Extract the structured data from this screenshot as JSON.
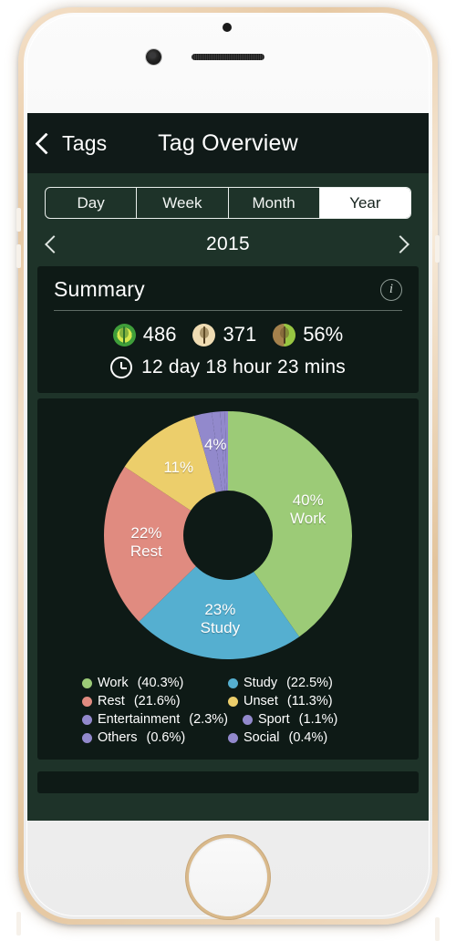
{
  "navbar": {
    "back_label": "Tags",
    "back_icon": "chevron-left-icon",
    "title": "Tag Overview"
  },
  "segmented": {
    "options": [
      "Day",
      "Week",
      "Month",
      "Year"
    ],
    "selected": "Year"
  },
  "period": {
    "prev_icon": "chevron-left-icon",
    "next_icon": "chevron-right-icon",
    "label": "2015"
  },
  "summary": {
    "title": "Summary",
    "info_icon": "info-icon",
    "stats": [
      {
        "icon": "tree-alive-icon",
        "value": "486"
      },
      {
        "icon": "tree-dead-icon",
        "value": "371"
      },
      {
        "icon": "tree-split-icon",
        "value": "56%"
      }
    ],
    "time_icon": "clock-icon",
    "time_text": "12 day 18 hour 23 mins"
  },
  "chart_data": {
    "type": "pie",
    "title": "",
    "donut": true,
    "start_angle_deg": 0,
    "direction": "clockwise",
    "categories": [
      "Work",
      "Study",
      "Rest",
      "Unset",
      "Entertainment",
      "Sport",
      "Others",
      "Social"
    ],
    "values": [
      40.3,
      22.5,
      21.6,
      11.3,
      2.3,
      1.1,
      0.6,
      0.4
    ],
    "colors": [
      "#9ccb77",
      "#55afd0",
      "#e08b80",
      "#ecce6b",
      "#9289cc",
      "#9289cc",
      "#9289cc",
      "#9289cc"
    ],
    "slice_labels": [
      {
        "pct": "40%",
        "name": "Work"
      },
      {
        "pct": "23%",
        "name": "Study"
      },
      {
        "pct": "22%",
        "name": "Rest"
      },
      {
        "pct": "11%",
        "name": ""
      },
      {
        "pct": "4%",
        "name": ""
      }
    ],
    "legend_position": "bottom",
    "legend": [
      {
        "label": "Work",
        "pct": "(40.3%)",
        "color": "#9ccb77"
      },
      {
        "label": "Study",
        "pct": "(22.5%)",
        "color": "#55afd0"
      },
      {
        "label": "Rest",
        "pct": "(21.6%)",
        "color": "#e08b80"
      },
      {
        "label": "Unset",
        "pct": "(11.3%)",
        "color": "#ecce6b"
      },
      {
        "label": "Entertainment",
        "pct": "(2.3%)",
        "color": "#9289cc"
      },
      {
        "label": "Sport",
        "pct": "(1.1%)",
        "color": "#9289cc"
      },
      {
        "label": "Others",
        "pct": "(0.6%)",
        "color": "#9289cc"
      },
      {
        "label": "Social",
        "pct": "(0.4%)",
        "color": "#9289cc"
      }
    ]
  },
  "theme": {
    "screen_bg": "#1e3329",
    "navbar_bg": "#101a18",
    "card_bg": "#0e1a16",
    "text": "#ffffff"
  }
}
